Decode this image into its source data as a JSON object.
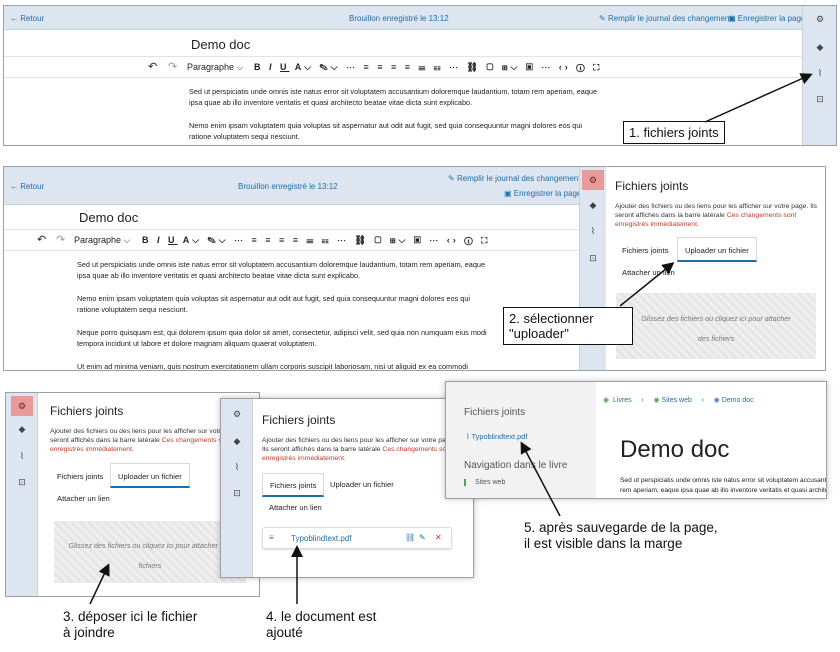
{
  "editor": {
    "back": "← Retour",
    "draft_status": "Brouillon enregistré le 13:12",
    "changelog": "Remplir le journal des changements",
    "save": "Enregistrer la page",
    "doc_title": "Demo doc",
    "format": "Paragraphe",
    "paragraphs": [
      "Sed ut perspiciatis unde omnis iste natus error sit voluptatem accusantium doloremque laudantium, totam rem aperiam, eaque ipsa quae ab illo inventore veritatis et quasi architecto beatae vitae dicta sunt explicabo.",
      "Nemo enim ipsam voluptatem quia voluptas sit aspernatur aut odit aut fugit, sed quia consequuntur magni dolores eos qui ratione voluptatem sequi nesciunt.",
      "Neque porro quisquam est, qui dolorem ipsum quia dolor sit amet, consectetur, adipisci velit, sed quia non numquam eius modi tempora incidunt ut labore et dolore magnam aliquam quaerat voluptatem.",
      "Ut enim ad minima veniam, quis nostrum exercitationem ullam corporis suscipit laboriosam, nisi ut aliquid ex ea commodi"
    ]
  },
  "attachments": {
    "title": "Fichiers joints",
    "desc": "Ajouter des fichiers ou des liens pour les afficher sur votre page. Ils seront affichés dans la barre latérale",
    "desc_warn": "Ces changements sont enregistrés immédiatement.",
    "tab_files": "Fichiers joints",
    "tab_upload": "Uploader un fichier",
    "tab_link": "Attacher un lien",
    "dropzone": "Glissez des fichiers ou cliquez ici pour attacher des fichiers",
    "file_name": "Typoblindtext.pdf"
  },
  "published": {
    "crumb_books": "Livres",
    "crumb_shelf": "Sites web",
    "crumb_doc": "Demo doc",
    "side_title": "Fichiers joints",
    "file_link": "Typoblindtext.pdf",
    "nav_title": "Navigation dans le livre",
    "nav_item": "Sites web",
    "doc_heading": "Demo doc",
    "body": "Sed ut perspiciatis unde omnis iste natus error sit voluptatem accusantium doloremque laudantium, totam rem aperiam, eaque ipsa quae ab illo inventore veritatis et quasi architecto beatae vitae dicta sunt explicabo."
  },
  "annotations": {
    "step1": "1. fichiers joints",
    "step2": "2. sélectionner \"uploader\"",
    "step3": "3. déposer ici le fichier à joindre",
    "step4": "4. le document est ajouté",
    "step5": "5. après sauvegarde de la page, il est visible dans la marge"
  }
}
